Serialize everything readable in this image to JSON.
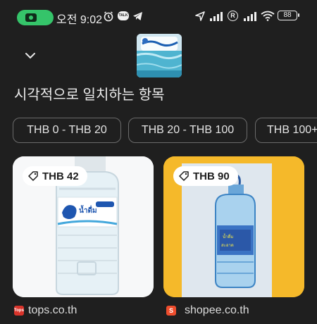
{
  "status_bar": {
    "time": "오전 9:02",
    "battery": "88",
    "talk_badge": "TALK"
  },
  "header": {
    "collapse_icon": "chevron-down-icon",
    "title": "시각적으로 일치하는 항목"
  },
  "price_filters": [
    {
      "label": "THB 0 - THB 20"
    },
    {
      "label": "THB 20 - THB 100"
    },
    {
      "label": "THB 100+"
    }
  ],
  "results": [
    {
      "price": "THB 42",
      "source": "tops.co.th",
      "favicon_text": "Tops",
      "favicon_color": "#d9342b"
    },
    {
      "price": "THB 90",
      "source": "shopee.co.th",
      "favicon_text": "S",
      "favicon_color": "#ee4d2d"
    }
  ],
  "colors": {
    "background": "#1f1f1f",
    "chip_border": "#6b6b6b",
    "recording_pill": "#35c46a",
    "card_yellow": "#f5b92a"
  }
}
